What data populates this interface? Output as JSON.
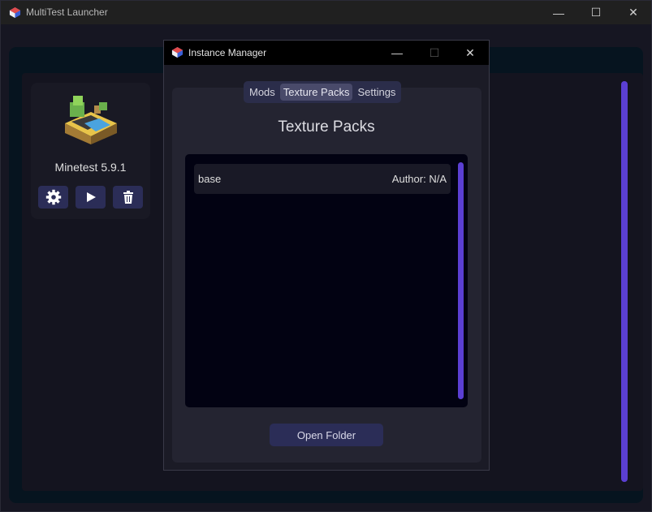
{
  "main_window": {
    "title": "MultiTest Launcher",
    "controls": {
      "minimize": "—",
      "maximize": "☐",
      "close": "✕"
    }
  },
  "instance": {
    "name": "Minetest 5.9.1",
    "logo_icon": "minetest-logo-icon",
    "buttons": [
      {
        "name": "settings",
        "icon": "gear-icon"
      },
      {
        "name": "play",
        "icon": "play-icon"
      },
      {
        "name": "delete",
        "icon": "trash-icon"
      }
    ]
  },
  "dialog": {
    "title": "Instance Manager",
    "controls": {
      "minimize": "—",
      "maximize": "☐",
      "close": "✕"
    },
    "tabs": [
      {
        "label": "Mods",
        "active": false
      },
      {
        "label": "Texture Packs",
        "active": true
      },
      {
        "label": "Settings",
        "active": false
      }
    ],
    "heading": "Texture Packs",
    "packs": [
      {
        "name": "base",
        "author": "Author: N/A"
      }
    ],
    "open_folder_label": "Open Folder"
  },
  "colors": {
    "accent": "#5b3fd3",
    "button": "#2b2d57",
    "background": "#161622"
  }
}
